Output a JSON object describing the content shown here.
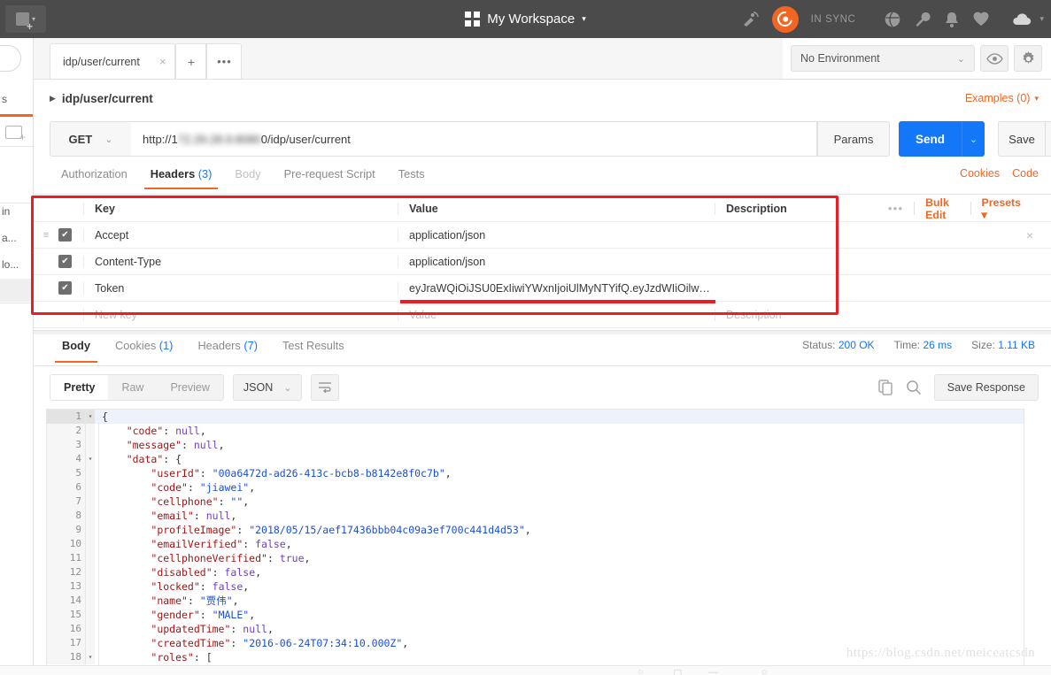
{
  "topbar": {
    "new_button": {
      "label": "New",
      "icon": "new-square-icon",
      "caret": "▾"
    },
    "workspace": {
      "title": "My Workspace",
      "caret": "▾",
      "grid_icon": "grid-icon"
    },
    "sync_status": "IN SYNC",
    "icons": [
      "satellite-icon",
      "postman-logo-icon",
      "globe-icon",
      "wrench-icon",
      "bell-icon",
      "heart-icon",
      "cloud-icon"
    ],
    "cloud_caret": "▾"
  },
  "sidebar": {
    "fragments": [
      "s",
      "in",
      "a...",
      "lo..."
    ],
    "new_folder_icon": "new-folder-icon"
  },
  "environment": {
    "selected": "No Environment",
    "caret": "⌄",
    "eye_icon": "eye-icon",
    "gear_icon": "gear-icon"
  },
  "tabs": {
    "open_tab": {
      "label": "idp/user/current",
      "close": "×"
    },
    "new_tab": "+",
    "more": "•••"
  },
  "breadcrumb": {
    "arrow": "▶",
    "text": "idp/user/current",
    "examples": "Examples (0)",
    "examples_caret": "▾"
  },
  "request": {
    "method": "GET",
    "method_caret": "⌄",
    "url_prefix": "http://1",
    "url_blurred": "72.29.28.9.8080",
    "url_suffix": "0/idp/user/current",
    "params_label": "Params",
    "send_label": "Send",
    "send_caret": "⌄",
    "save_label": "Save",
    "save_caret": "⌄"
  },
  "request_tabs": {
    "items": [
      {
        "label": "Authorization",
        "count": "",
        "state": "normal"
      },
      {
        "label": "Headers",
        "count": "(3)",
        "state": "active"
      },
      {
        "label": "Body",
        "count": "",
        "state": "dim"
      },
      {
        "label": "Pre-request Script",
        "count": "",
        "state": "normal"
      },
      {
        "label": "Tests",
        "count": "",
        "state": "normal"
      }
    ],
    "cookies": "Cookies",
    "code": "Code"
  },
  "headers_table": {
    "columns": {
      "key": "Key",
      "value": "Value",
      "description": "Description"
    },
    "tools": {
      "dots": "•••",
      "bulk_edit": "Bulk Edit",
      "presets": "Presets",
      "presets_caret": "▾"
    },
    "rows": [
      {
        "checked": true,
        "key": "Accept",
        "value": "application/json",
        "description": "",
        "remove": "×"
      },
      {
        "checked": true,
        "key": "Content-Type",
        "value": "application/json",
        "description": "",
        "remove": ""
      },
      {
        "checked": true,
        "key": "Token",
        "value": "eyJraWQiOiJSU0ExIiwiYWxnIjoiUlMyNTYifQ.eyJzdWIiOilwMG...",
        "description": "",
        "remove": ""
      }
    ],
    "new_row": {
      "key_placeholder": "New key",
      "value_placeholder": "Value",
      "desc_placeholder": "Description"
    },
    "grip_icon": "drag-grip-icon",
    "check_glyph": "✔"
  },
  "response_tabs": {
    "items": [
      {
        "label": "Body",
        "count": "",
        "state": "active"
      },
      {
        "label": "Cookies",
        "count": "(1)",
        "state": "normal"
      },
      {
        "label": "Headers",
        "count": "(7)",
        "state": "normal"
      },
      {
        "label": "Test Results",
        "count": "",
        "state": "normal"
      }
    ],
    "status_label": "Status:",
    "status_value": "200 OK",
    "time_label": "Time:",
    "time_value": "26 ms",
    "size_label": "Size:",
    "size_value": "1.11 KB"
  },
  "response_toolbar": {
    "view_modes": [
      {
        "label": "Pretty",
        "active": true
      },
      {
        "label": "Raw",
        "active": false
      },
      {
        "label": "Preview",
        "active": false
      }
    ],
    "format": "JSON",
    "format_caret": "⌄",
    "wrap_icon": "word-wrap-icon",
    "copy_icon": "copy-icon",
    "search_icon": "search-icon",
    "save_response": "Save Response"
  },
  "response_body": {
    "language": "json",
    "lines": [
      {
        "num": "1",
        "fold": true,
        "indent": 0,
        "tokens": [
          {
            "t": "p",
            "v": "{"
          }
        ]
      },
      {
        "num": "2",
        "fold": false,
        "indent": 1,
        "tokens": [
          {
            "t": "k",
            "v": "\"code\""
          },
          {
            "t": "p",
            "v": ": "
          },
          {
            "t": "n",
            "v": "null"
          },
          {
            "t": "p",
            "v": ","
          }
        ]
      },
      {
        "num": "3",
        "fold": false,
        "indent": 1,
        "tokens": [
          {
            "t": "k",
            "v": "\"message\""
          },
          {
            "t": "p",
            "v": ": "
          },
          {
            "t": "n",
            "v": "null"
          },
          {
            "t": "p",
            "v": ","
          }
        ]
      },
      {
        "num": "4",
        "fold": true,
        "indent": 1,
        "tokens": [
          {
            "t": "k",
            "v": "\"data\""
          },
          {
            "t": "p",
            "v": ": {"
          }
        ]
      },
      {
        "num": "5",
        "fold": false,
        "indent": 2,
        "tokens": [
          {
            "t": "k",
            "v": "\"userId\""
          },
          {
            "t": "p",
            "v": ": "
          },
          {
            "t": "s",
            "v": "\"00a6472d-ad26-413c-bcb8-b8142e8f0c7b\""
          },
          {
            "t": "p",
            "v": ","
          }
        ]
      },
      {
        "num": "6",
        "fold": false,
        "indent": 2,
        "tokens": [
          {
            "t": "k",
            "v": "\"code\""
          },
          {
            "t": "p",
            "v": ": "
          },
          {
            "t": "s",
            "v": "\"jiawei\""
          },
          {
            "t": "p",
            "v": ","
          }
        ]
      },
      {
        "num": "7",
        "fold": false,
        "indent": 2,
        "tokens": [
          {
            "t": "k",
            "v": "\"cellphone\""
          },
          {
            "t": "p",
            "v": ": "
          },
          {
            "t": "s",
            "v": "\"\""
          },
          {
            "t": "p",
            "v": ","
          }
        ]
      },
      {
        "num": "8",
        "fold": false,
        "indent": 2,
        "tokens": [
          {
            "t": "k",
            "v": "\"email\""
          },
          {
            "t": "p",
            "v": ": "
          },
          {
            "t": "n",
            "v": "null"
          },
          {
            "t": "p",
            "v": ","
          }
        ]
      },
      {
        "num": "9",
        "fold": false,
        "indent": 2,
        "tokens": [
          {
            "t": "k",
            "v": "\"profileImage\""
          },
          {
            "t": "p",
            "v": ": "
          },
          {
            "t": "s",
            "v": "\"2018/05/15/aef17436bbb04c09a3ef700c441d4d53\""
          },
          {
            "t": "p",
            "v": ","
          }
        ]
      },
      {
        "num": "10",
        "fold": false,
        "indent": 2,
        "tokens": [
          {
            "t": "k",
            "v": "\"emailVerified\""
          },
          {
            "t": "p",
            "v": ": "
          },
          {
            "t": "n",
            "v": "false"
          },
          {
            "t": "p",
            "v": ","
          }
        ]
      },
      {
        "num": "11",
        "fold": false,
        "indent": 2,
        "tokens": [
          {
            "t": "k",
            "v": "\"cellphoneVerified\""
          },
          {
            "t": "p",
            "v": ": "
          },
          {
            "t": "n",
            "v": "true"
          },
          {
            "t": "p",
            "v": ","
          }
        ]
      },
      {
        "num": "12",
        "fold": false,
        "indent": 2,
        "tokens": [
          {
            "t": "k",
            "v": "\"disabled\""
          },
          {
            "t": "p",
            "v": ": "
          },
          {
            "t": "n",
            "v": "false"
          },
          {
            "t": "p",
            "v": ","
          }
        ]
      },
      {
        "num": "13",
        "fold": false,
        "indent": 2,
        "tokens": [
          {
            "t": "k",
            "v": "\"locked\""
          },
          {
            "t": "p",
            "v": ": "
          },
          {
            "t": "n",
            "v": "false"
          },
          {
            "t": "p",
            "v": ","
          }
        ]
      },
      {
        "num": "14",
        "fold": false,
        "indent": 2,
        "tokens": [
          {
            "t": "k",
            "v": "\"name\""
          },
          {
            "t": "p",
            "v": ": "
          },
          {
            "t": "s",
            "v": "\"贾伟\""
          },
          {
            "t": "p",
            "v": ","
          }
        ]
      },
      {
        "num": "15",
        "fold": false,
        "indent": 2,
        "tokens": [
          {
            "t": "k",
            "v": "\"gender\""
          },
          {
            "t": "p",
            "v": ": "
          },
          {
            "t": "s",
            "v": "\"MALE\""
          },
          {
            "t": "p",
            "v": ","
          }
        ]
      },
      {
        "num": "16",
        "fold": false,
        "indent": 2,
        "tokens": [
          {
            "t": "k",
            "v": "\"updatedTime\""
          },
          {
            "t": "p",
            "v": ": "
          },
          {
            "t": "n",
            "v": "null"
          },
          {
            "t": "p",
            "v": ","
          }
        ]
      },
      {
        "num": "17",
        "fold": false,
        "indent": 2,
        "tokens": [
          {
            "t": "k",
            "v": "\"createdTime\""
          },
          {
            "t": "p",
            "v": ": "
          },
          {
            "t": "s",
            "v": "\"2016-06-24T07:34:10.000Z\""
          },
          {
            "t": "p",
            "v": ","
          }
        ]
      },
      {
        "num": "18",
        "fold": true,
        "indent": 2,
        "tokens": [
          {
            "t": "k",
            "v": "\"roles\""
          },
          {
            "t": "p",
            "v": ": ["
          }
        ]
      }
    ]
  },
  "watermark": "https://blog.csdn.net/meiceatcsdn",
  "colors": {
    "accent_orange": "#f26522",
    "send_blue": "#1477f8",
    "topbar_dark": "#4b4b4b",
    "annotation_red": "#ee1c25"
  }
}
